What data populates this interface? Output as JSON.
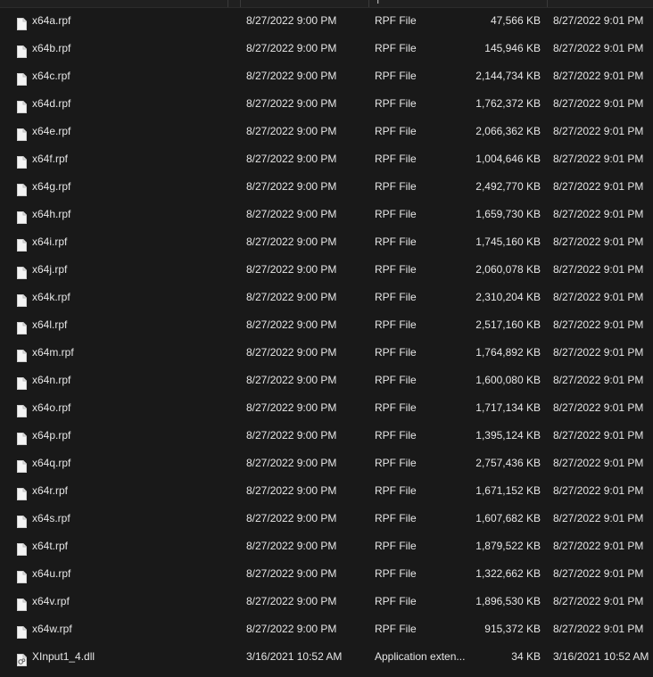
{
  "header": {
    "type_partial": "T"
  },
  "files": [
    {
      "name": "x64a.rpf",
      "date_modified": "8/27/2022 9:00 PM",
      "type": "RPF File",
      "size": "47,566 KB",
      "date_created": "8/27/2022 9:01 PM",
      "icon": "file-icon"
    },
    {
      "name": "x64b.rpf",
      "date_modified": "8/27/2022 9:00 PM",
      "type": "RPF File",
      "size": "145,946 KB",
      "date_created": "8/27/2022 9:01 PM",
      "icon": "file-icon"
    },
    {
      "name": "x64c.rpf",
      "date_modified": "8/27/2022 9:00 PM",
      "type": "RPF File",
      "size": "2,144,734 KB",
      "date_created": "8/27/2022 9:01 PM",
      "icon": "file-icon"
    },
    {
      "name": "x64d.rpf",
      "date_modified": "8/27/2022 9:00 PM",
      "type": "RPF File",
      "size": "1,762,372 KB",
      "date_created": "8/27/2022 9:01 PM",
      "icon": "file-icon"
    },
    {
      "name": "x64e.rpf",
      "date_modified": "8/27/2022 9:00 PM",
      "type": "RPF File",
      "size": "2,066,362 KB",
      "date_created": "8/27/2022 9:01 PM",
      "icon": "file-icon"
    },
    {
      "name": "x64f.rpf",
      "date_modified": "8/27/2022 9:00 PM",
      "type": "RPF File",
      "size": "1,004,646 KB",
      "date_created": "8/27/2022 9:01 PM",
      "icon": "file-icon"
    },
    {
      "name": "x64g.rpf",
      "date_modified": "8/27/2022 9:00 PM",
      "type": "RPF File",
      "size": "2,492,770 KB",
      "date_created": "8/27/2022 9:01 PM",
      "icon": "file-icon"
    },
    {
      "name": "x64h.rpf",
      "date_modified": "8/27/2022 9:00 PM",
      "type": "RPF File",
      "size": "1,659,730 KB",
      "date_created": "8/27/2022 9:01 PM",
      "icon": "file-icon"
    },
    {
      "name": "x64i.rpf",
      "date_modified": "8/27/2022 9:00 PM",
      "type": "RPF File",
      "size": "1,745,160 KB",
      "date_created": "8/27/2022 9:01 PM",
      "icon": "file-icon"
    },
    {
      "name": "x64j.rpf",
      "date_modified": "8/27/2022 9:00 PM",
      "type": "RPF File",
      "size": "2,060,078 KB",
      "date_created": "8/27/2022 9:01 PM",
      "icon": "file-icon"
    },
    {
      "name": "x64k.rpf",
      "date_modified": "8/27/2022 9:00 PM",
      "type": "RPF File",
      "size": "2,310,204 KB",
      "date_created": "8/27/2022 9:01 PM",
      "icon": "file-icon"
    },
    {
      "name": "x64l.rpf",
      "date_modified": "8/27/2022 9:00 PM",
      "type": "RPF File",
      "size": "2,517,160 KB",
      "date_created": "8/27/2022 9:01 PM",
      "icon": "file-icon"
    },
    {
      "name": "x64m.rpf",
      "date_modified": "8/27/2022 9:00 PM",
      "type": "RPF File",
      "size": "1,764,892 KB",
      "date_created": "8/27/2022 9:01 PM",
      "icon": "file-icon"
    },
    {
      "name": "x64n.rpf",
      "date_modified": "8/27/2022 9:00 PM",
      "type": "RPF File",
      "size": "1,600,080 KB",
      "date_created": "8/27/2022 9:01 PM",
      "icon": "file-icon"
    },
    {
      "name": "x64o.rpf",
      "date_modified": "8/27/2022 9:00 PM",
      "type": "RPF File",
      "size": "1,717,134 KB",
      "date_created": "8/27/2022 9:01 PM",
      "icon": "file-icon"
    },
    {
      "name": "x64p.rpf",
      "date_modified": "8/27/2022 9:00 PM",
      "type": "RPF File",
      "size": "1,395,124 KB",
      "date_created": "8/27/2022 9:01 PM",
      "icon": "file-icon"
    },
    {
      "name": "x64q.rpf",
      "date_modified": "8/27/2022 9:00 PM",
      "type": "RPF File",
      "size": "2,757,436 KB",
      "date_created": "8/27/2022 9:01 PM",
      "icon": "file-icon"
    },
    {
      "name": "x64r.rpf",
      "date_modified": "8/27/2022 9:00 PM",
      "type": "RPF File",
      "size": "1,671,152 KB",
      "date_created": "8/27/2022 9:01 PM",
      "icon": "file-icon"
    },
    {
      "name": "x64s.rpf",
      "date_modified": "8/27/2022 9:00 PM",
      "type": "RPF File",
      "size": "1,607,682 KB",
      "date_created": "8/27/2022 9:01 PM",
      "icon": "file-icon"
    },
    {
      "name": "x64t.rpf",
      "date_modified": "8/27/2022 9:00 PM",
      "type": "RPF File",
      "size": "1,879,522 KB",
      "date_created": "8/27/2022 9:01 PM",
      "icon": "file-icon"
    },
    {
      "name": "x64u.rpf",
      "date_modified": "8/27/2022 9:00 PM",
      "type": "RPF File",
      "size": "1,322,662 KB",
      "date_created": "8/27/2022 9:01 PM",
      "icon": "file-icon"
    },
    {
      "name": "x64v.rpf",
      "date_modified": "8/27/2022 9:00 PM",
      "type": "RPF File",
      "size": "1,896,530 KB",
      "date_created": "8/27/2022 9:01 PM",
      "icon": "file-icon"
    },
    {
      "name": "x64w.rpf",
      "date_modified": "8/27/2022 9:00 PM",
      "type": "RPF File",
      "size": "915,372 KB",
      "date_created": "8/27/2022 9:01 PM",
      "icon": "file-icon"
    },
    {
      "name": "XInput1_4.dll",
      "date_modified": "3/16/2021 10:52 AM",
      "type": "Application exten...",
      "size": "34 KB",
      "date_created": "3/16/2021 10:52 AM",
      "icon": "dll-file-icon"
    }
  ],
  "colors": {
    "background": "#191919",
    "text": "#e6e6e6",
    "header": "#202020"
  }
}
